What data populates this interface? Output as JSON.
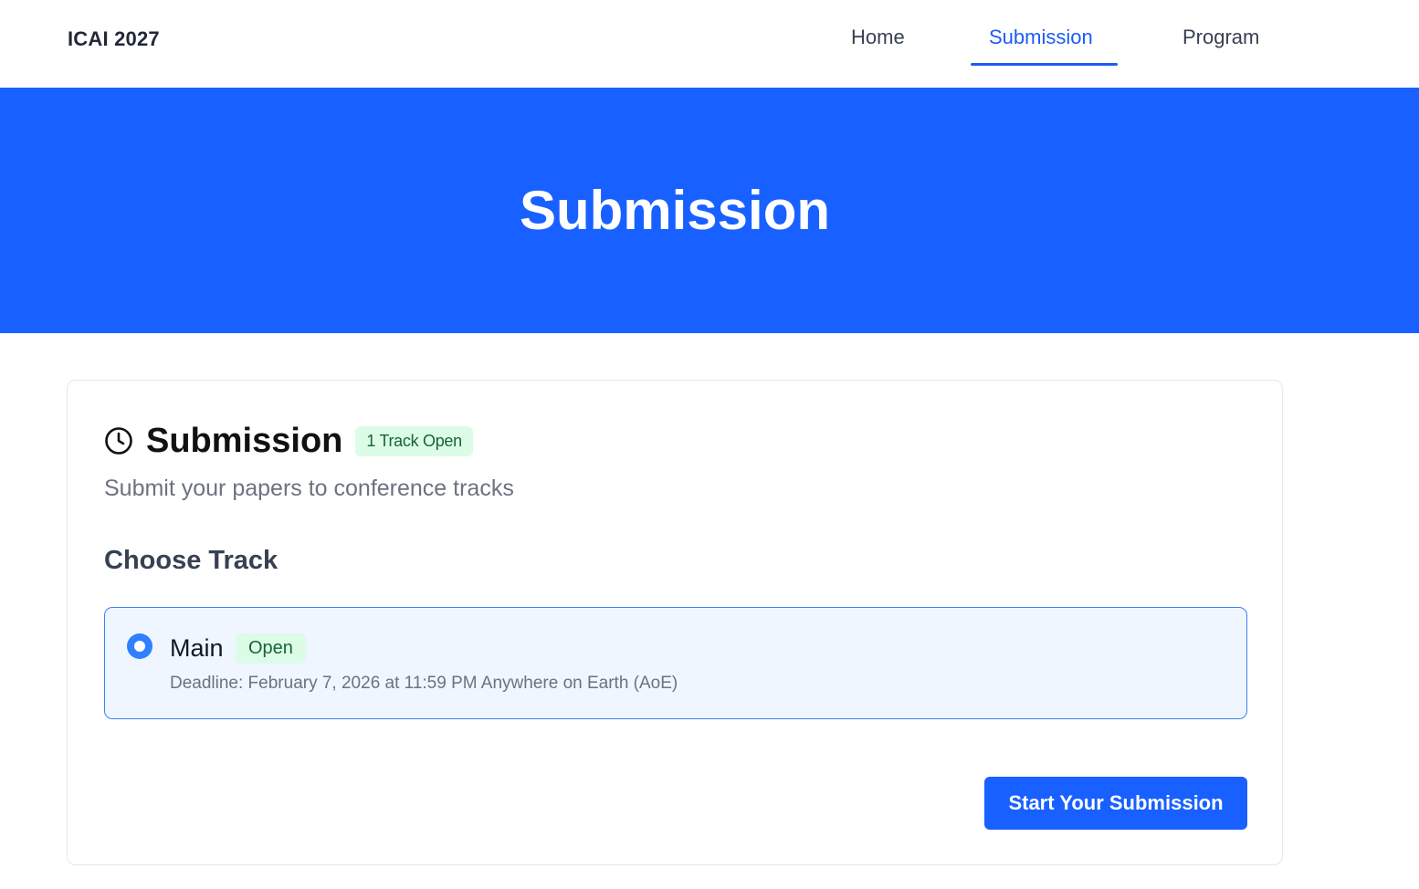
{
  "header": {
    "brand": "ICAI 2027",
    "nav": {
      "home": "Home",
      "submission": "Submission",
      "program": "Program"
    },
    "active_tab": "Submission",
    "accent_color": "#1d5cf5"
  },
  "hero": {
    "title": "Submission",
    "background_color": "#1860ff"
  },
  "card": {
    "icon": "clock-icon",
    "title": "Submission",
    "badge": "1 Track Open",
    "subtitle": "Submit your papers to conference tracks",
    "section_title": "Choose Track",
    "tracks": [
      {
        "name": "Main",
        "status": "Open",
        "deadline": "Deadline: February 7, 2026 at 11:59 PM Anywhere on Earth (AoE)",
        "selected": true
      }
    ],
    "start_button": "Start Your Submission"
  }
}
